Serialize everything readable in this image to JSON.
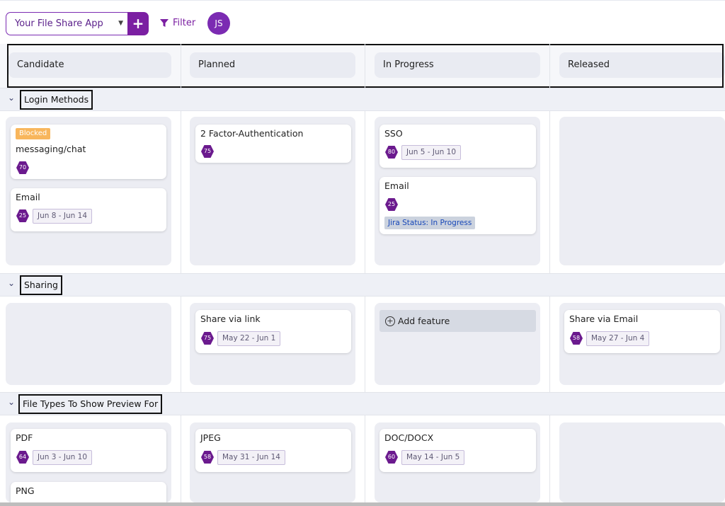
{
  "toolbar": {
    "app_select_value": "Your File Share App",
    "add_label": "+",
    "filter_label": "Filter",
    "avatar_initials": "JS"
  },
  "columns": [
    "Candidate",
    "Planned",
    "In Progress",
    "Released"
  ],
  "groups": {
    "login_methods": {
      "title": "Login Methods",
      "cards": {
        "messaging": {
          "badge": "Blocked",
          "title": "messaging/chat",
          "score": "70"
        },
        "email_candidate": {
          "title": "Email",
          "score": "25",
          "dates": "Jun 8 - Jun 14"
        },
        "twofa": {
          "title": "2 Factor-Authentication",
          "score": "75"
        },
        "sso": {
          "title": "SSO",
          "score": "80",
          "dates": "Jun 5 - Jun 10"
        },
        "email_progress": {
          "title": "Email",
          "score": "25",
          "jira": "Jira Status: In Progress"
        }
      }
    },
    "sharing": {
      "title": "Sharing",
      "add_feature_label": "Add feature",
      "cards": {
        "share_link": {
          "title": "Share via link",
          "score": "75",
          "dates": "May 22 - Jun 1"
        },
        "share_email": {
          "title": "Share via Email",
          "score": "58",
          "dates": "May 27 - Jun 4"
        }
      }
    },
    "file_types": {
      "title": "File Types To Show Preview For",
      "cards": {
        "pdf": {
          "title": "PDF",
          "score": "64",
          "dates": "Jun 3 - Jun 10"
        },
        "png": {
          "title": "PNG"
        },
        "jpeg": {
          "title": "JPEG",
          "score": "58",
          "dates": "May 31 - Jun 14"
        },
        "doc": {
          "title": "DOC/DOCX",
          "score": "60",
          "dates": "May 14 - Jun 5"
        }
      }
    }
  },
  "colors": {
    "brand": "#7b1fa2",
    "blocked": "#f8b65c",
    "lane": "#ecedf3",
    "group_header": "#eef0f6"
  }
}
